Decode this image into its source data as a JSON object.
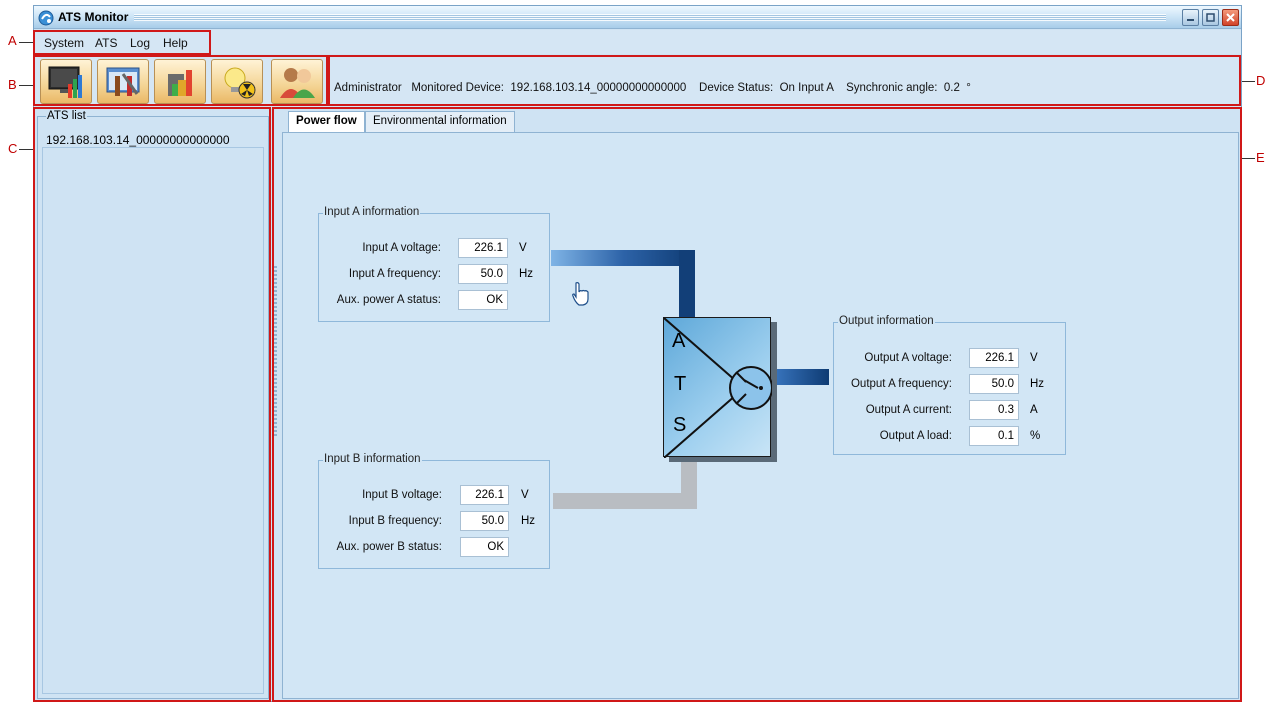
{
  "callouts": {
    "a": "A",
    "b": "B",
    "c": "C",
    "d": "D",
    "e": "E"
  },
  "window": {
    "title": "ATS Monitor"
  },
  "menu": {
    "system": "System",
    "ats": "ATS",
    "log": "Log",
    "help": "Help"
  },
  "toolbar": {
    "buttons": [
      {
        "icon": "monitor-chart-icon"
      },
      {
        "icon": "settings-tools-icon"
      },
      {
        "icon": "building-chart-icon"
      },
      {
        "icon": "lightbulb-warning-icon"
      },
      {
        "icon": "users-icon"
      }
    ],
    "status": "Administrator   Monitored Device:  192.168.103.14_00000000000000    Device Status:  On Input A    Synchronic angle:  0.2  °"
  },
  "ats_list": {
    "legend": "ATS list",
    "items": [
      "192.168.103.14_00000000000000"
    ]
  },
  "tabs": {
    "power_flow": "Power flow",
    "environmental": "Environmental information"
  },
  "input_a": {
    "legend": "Input A information",
    "voltage_label": "Input A voltage:",
    "voltage_value": "226.1",
    "voltage_unit": "V",
    "frequency_label": "Input A frequency:",
    "frequency_value": "50.0",
    "frequency_unit": "Hz",
    "aux_label": "Aux. power A status:",
    "aux_value": "OK"
  },
  "input_b": {
    "legend": "Input B information",
    "voltage_label": "Input B voltage:",
    "voltage_value": "226.1",
    "voltage_unit": "V",
    "frequency_label": "Input B frequency:",
    "frequency_value": "50.0",
    "frequency_unit": "Hz",
    "aux_label": "Aux. power B status:",
    "aux_value": "OK"
  },
  "output": {
    "legend": "Output information",
    "voltage_label": "Output A voltage:",
    "voltage_value": "226.1",
    "voltage_unit": "V",
    "frequency_label": "Output A frequency:",
    "frequency_value": "50.0",
    "frequency_unit": "Hz",
    "current_label": "Output A current:",
    "current_value": "0.3",
    "current_unit": "A",
    "load_label": "Output A load:",
    "load_value": "0.1",
    "load_unit": "%"
  },
  "ats_diagram": {
    "letters": [
      "A",
      "T",
      "S"
    ]
  },
  "colors": {
    "active_line": "#0e3b73",
    "inactive_line": "#b8bcc2",
    "annotation": "#d01818"
  }
}
